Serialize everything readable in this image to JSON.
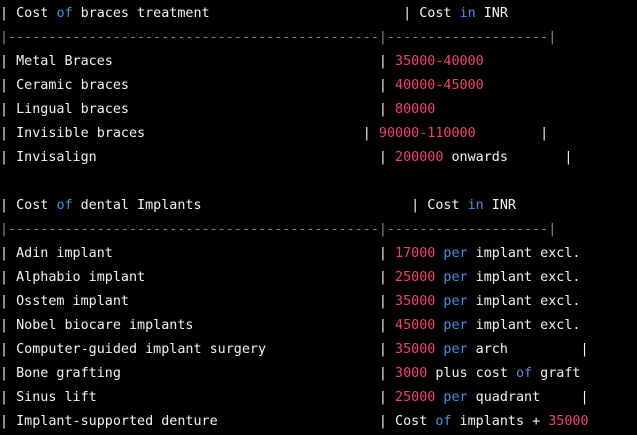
{
  "colors": {
    "text": "#f2f2f2",
    "keyword": "#4a90e2",
    "number": "#f2416e",
    "background": "#000000"
  },
  "lines": [
    {
      "segs": [
        {
          "t": "| Cost ",
          "c": "w"
        },
        {
          "t": "of",
          "c": "b"
        },
        {
          "t": " braces treatment                        | Cost ",
          "c": "w"
        },
        {
          "t": "in",
          "c": "b"
        },
        {
          "t": " INR",
          "c": "w"
        }
      ]
    },
    {
      "segs": [
        {
          "t": "|----------------------------------------------|--------------------|",
          "c": "d"
        }
      ]
    },
    {
      "segs": [
        {
          "t": "| Metal Braces                                 | ",
          "c": "w"
        },
        {
          "t": "35000-40000",
          "c": "r"
        }
      ]
    },
    {
      "segs": [
        {
          "t": "| Ceramic braces                               | ",
          "c": "w"
        },
        {
          "t": "40000-45000",
          "c": "r"
        }
      ]
    },
    {
      "segs": [
        {
          "t": "| Lingual braces                               | ",
          "c": "w"
        },
        {
          "t": "80000",
          "c": "r"
        }
      ]
    },
    {
      "segs": [
        {
          "t": "| Invisible braces                           | ",
          "c": "w"
        },
        {
          "t": "90000-110000",
          "c": "r"
        },
        {
          "t": "        |",
          "c": "w"
        }
      ]
    },
    {
      "segs": [
        {
          "t": "| Invisalign                                   | ",
          "c": "w"
        },
        {
          "t": "200000",
          "c": "r"
        },
        {
          "t": " onwards       |",
          "c": "w"
        }
      ]
    },
    {
      "segs": [
        {
          "t": "                                                                                          |",
          "c": "w"
        }
      ]
    },
    {
      "segs": [
        {
          "t": "| Cost ",
          "c": "w"
        },
        {
          "t": "of",
          "c": "b"
        },
        {
          "t": " dental Implants                          | Cost ",
          "c": "w"
        },
        {
          "t": "in",
          "c": "b"
        },
        {
          "t": " INR",
          "c": "w"
        }
      ]
    },
    {
      "segs": [
        {
          "t": "|----------------------------------------------|--------------------|",
          "c": "d"
        }
      ]
    },
    {
      "segs": [
        {
          "t": "| Adin implant                                 | ",
          "c": "w"
        },
        {
          "t": "17000",
          "c": "r"
        },
        {
          "t": " ",
          "c": "w"
        },
        {
          "t": "per",
          "c": "b"
        },
        {
          "t": " implant excl.",
          "c": "w"
        }
      ]
    },
    {
      "segs": [
        {
          "t": "| Alphabio implant                             | ",
          "c": "w"
        },
        {
          "t": "25000",
          "c": "r"
        },
        {
          "t": " ",
          "c": "w"
        },
        {
          "t": "per",
          "c": "b"
        },
        {
          "t": " implant excl.",
          "c": "w"
        }
      ]
    },
    {
      "segs": [
        {
          "t": "| Osstem implant                               | ",
          "c": "w"
        },
        {
          "t": "35000",
          "c": "r"
        },
        {
          "t": " ",
          "c": "w"
        },
        {
          "t": "per",
          "c": "b"
        },
        {
          "t": " implant excl.",
          "c": "w"
        }
      ]
    },
    {
      "segs": [
        {
          "t": "| Nobel biocare implants                       | ",
          "c": "w"
        },
        {
          "t": "45000",
          "c": "r"
        },
        {
          "t": " ",
          "c": "w"
        },
        {
          "t": "per",
          "c": "b"
        },
        {
          "t": " implant excl.",
          "c": "w"
        }
      ]
    },
    {
      "segs": [
        {
          "t": "| Computer-guided implant surgery              | ",
          "c": "w"
        },
        {
          "t": "35000",
          "c": "r"
        },
        {
          "t": " ",
          "c": "w"
        },
        {
          "t": "per",
          "c": "b"
        },
        {
          "t": " arch         |",
          "c": "w"
        }
      ]
    },
    {
      "segs": [
        {
          "t": "| Bone grafting                                | ",
          "c": "w"
        },
        {
          "t": "3000",
          "c": "r"
        },
        {
          "t": " plus cost ",
          "c": "w"
        },
        {
          "t": "of",
          "c": "b"
        },
        {
          "t": " graft",
          "c": "w"
        }
      ]
    },
    {
      "segs": [
        {
          "t": "| Sinus lift                                   | ",
          "c": "w"
        },
        {
          "t": "25000",
          "c": "r"
        },
        {
          "t": " ",
          "c": "w"
        },
        {
          "t": "per",
          "c": "b"
        },
        {
          "t": " quadrant     |",
          "c": "w"
        }
      ]
    },
    {
      "segs": [
        {
          "t": "| Implant-supported denture                    | Cost ",
          "c": "w"
        },
        {
          "t": "of",
          "c": "b"
        },
        {
          "t": " implants + ",
          "c": "w"
        },
        {
          "t": "35000",
          "c": "r"
        }
      ]
    }
  ]
}
